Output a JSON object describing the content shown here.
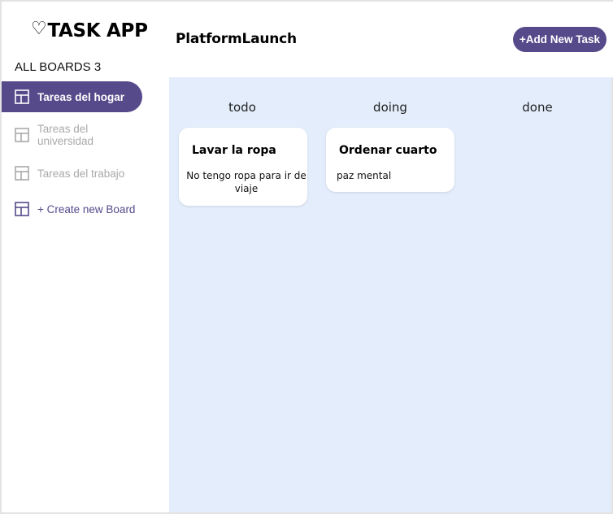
{
  "app": {
    "heart_glyph": "♡",
    "name": "TASK APP"
  },
  "sidebar": {
    "boards_count_label": "ALL BOARDS 3",
    "boards": [
      {
        "label": "Tareas del hogar",
        "active": true
      },
      {
        "label": "Tareas del universidad",
        "active": false
      },
      {
        "label": "Tareas del trabajo",
        "active": false
      }
    ],
    "create_label": "+ Create new Board"
  },
  "header": {
    "title": "PlatformLaunch",
    "add_task_label": "+Add New Task"
  },
  "columns": [
    {
      "title": "todo",
      "cards": [
        {
          "title": "Lavar la ropa",
          "description": "No tengo ropa para ir de viaje"
        }
      ]
    },
    {
      "title": "doing",
      "cards": [
        {
          "title": "Ordenar cuarto",
          "description": "paz mental"
        }
      ]
    },
    {
      "title": "done",
      "cards": []
    }
  ],
  "colors": {
    "accent": "#564a8a",
    "board_background": "#e3edfb",
    "inactive_text": "#a9a9a9"
  }
}
